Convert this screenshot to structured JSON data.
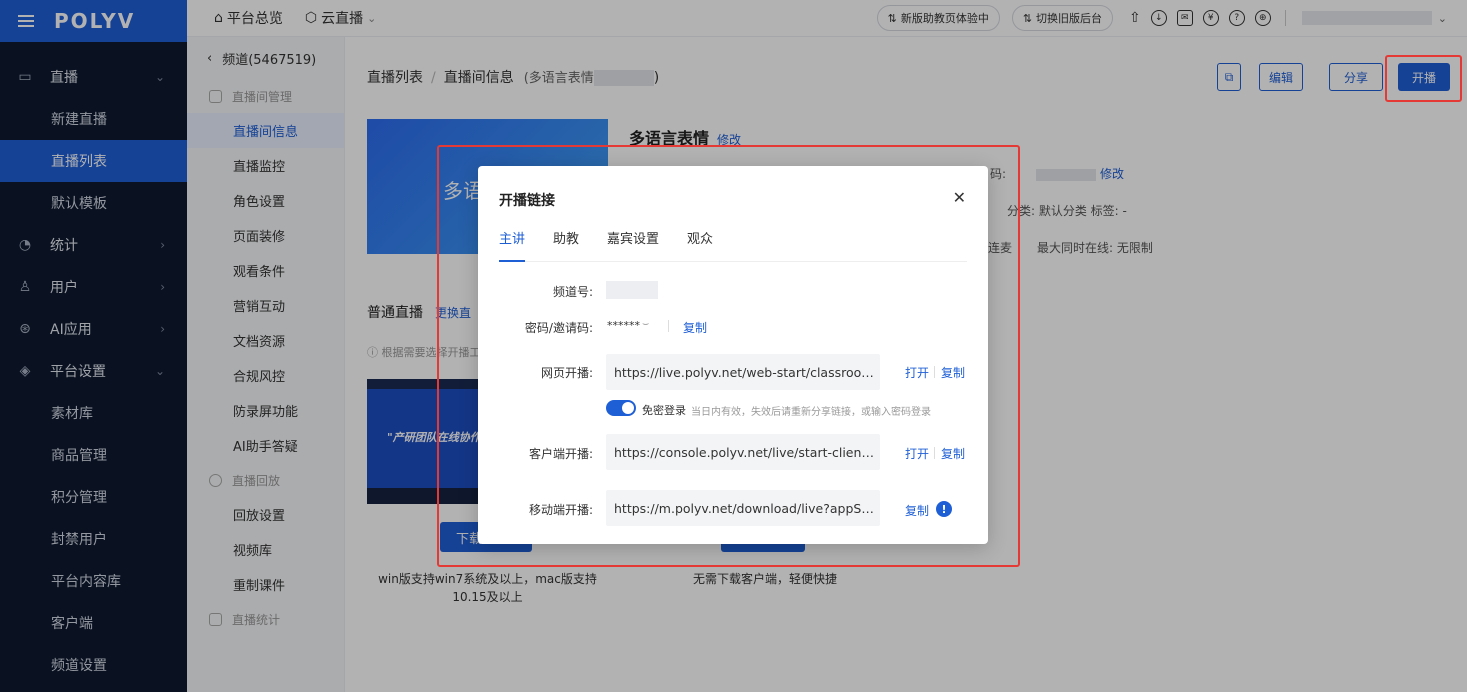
{
  "sidebar": {
    "logo": "POLYV",
    "groups": [
      {
        "label": "直播",
        "icon": "video-icon",
        "arrow": "⌄"
      },
      {
        "label": "统计",
        "icon": "chart-icon",
        "arrow": "›"
      },
      {
        "label": "用户",
        "icon": "user-icon",
        "arrow": "›"
      },
      {
        "label": "AI应用",
        "icon": "ai-icon",
        "arrow": "›"
      },
      {
        "label": "平台设置",
        "icon": "layers-icon",
        "arrow": "⌄"
      }
    ],
    "live_items": [
      "新建直播",
      "直播列表",
      "默认模板"
    ],
    "platform_items": [
      "素材库",
      "商品管理",
      "积分管理",
      "封禁用户",
      "平台内容库",
      "客户端",
      "频道设置"
    ]
  },
  "topbar": {
    "overview": "平台总览",
    "cloud_live": "云直播",
    "new_assistant": "新版助教页体验中",
    "switch_old": "切换旧版后台"
  },
  "subnav": {
    "back": "频道(5467519)",
    "section1": "直播间管理",
    "items1": [
      "直播间信息",
      "直播监控",
      "角色设置",
      "页面装修",
      "观看条件",
      "营销互动",
      "文档资源",
      "合规风控",
      "防录屏功能",
      "AI助手答疑"
    ],
    "section2": "直播回放",
    "items2": [
      "回放设置",
      "视频库",
      "重制课件"
    ],
    "section3": "直播统计"
  },
  "main": {
    "crumb_list": "直播列表",
    "crumb_info": "直播间信息",
    "crumb_meta": "(多语言表情",
    "btn_copy": "⧉",
    "btn_edit": "编辑",
    "btn_share": "分享",
    "btn_start": "开播",
    "cover_text": "多语",
    "title": "多语言表情",
    "title_edit": "修改",
    "pwd_label": "码:",
    "pwd_edit": "修改",
    "category": "分类:  默认分类     标签:  -",
    "mic": "连麦",
    "max_online": "最大同时在线:  无限制",
    "section_title": "普通直播",
    "section_link": "更换直",
    "hint": "ⓘ 根据需要选择开播工",
    "thumb_caption": "\"产研团队在线协作",
    "download_btn": "下载",
    "caption_left": "win版支持win7系统及以上，mac版支持 10.15及以上",
    "caption_right": "无需下载客户端，轻便快捷"
  },
  "modal": {
    "title": "开播链接",
    "close": "✕",
    "tabs": [
      "主讲",
      "助教",
      "嘉宾设置",
      "观众"
    ],
    "channel_label": "频道号:",
    "password_label": "密码/邀请码:",
    "password_value": "******",
    "copy": "复制",
    "open": "打开",
    "web_label": "网页开播:",
    "web_url": "https://live.polyv.net/web-start/classroom?c...",
    "nologin_label": "免密登录",
    "nologin_hint": "当日内有效，失效后请重新分享链接，或输入密码登录",
    "client_label": "客户端开播:",
    "client_url": "https://console.polyv.net/live/start-client.htm...",
    "mobile_label": "移动端开播:",
    "mobile_url": "https://m.polyv.net/download/live?appSche...",
    "no_login_enabled": true
  }
}
